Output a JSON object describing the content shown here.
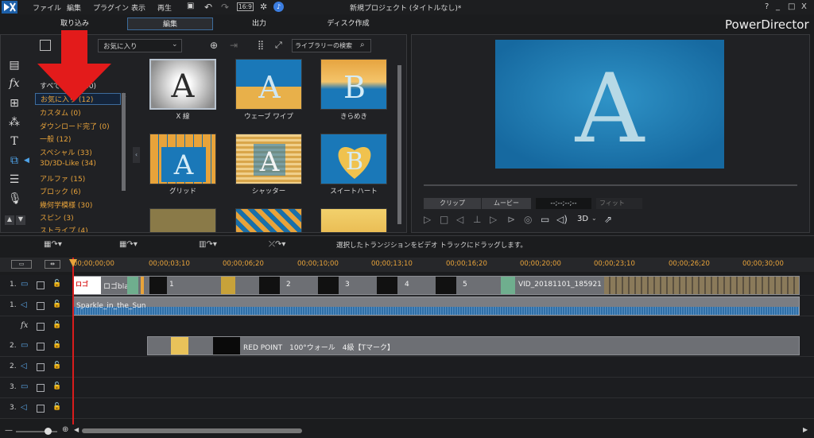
{
  "menu": {
    "file": "ファイル",
    "edit": "編集",
    "plugin": "プラグイン",
    "view": "表示",
    "play": "再生",
    "ratio": "16:9"
  },
  "window_title": "新規プロジェクト (タイトルなし)*",
  "winbtns": {
    "help": "?",
    "min": "_",
    "max": "□",
    "close": "X"
  },
  "modes": {
    "capture": "取り込み",
    "edit": "編集",
    "output": "出力",
    "disc": "ディスク作成"
  },
  "brand": "PowerDirector",
  "library": {
    "filter": "お気に入り",
    "search_placeholder": "ライブラリーの検索"
  },
  "categories": [
    {
      "label": "すべて表示 (140)"
    },
    {
      "label": "お気に入り (12)"
    },
    {
      "label": "カスタム (0)"
    },
    {
      "label": "ダウンロード完了 (0)"
    },
    {
      "label": "一般 (12)"
    },
    {
      "label": "スペシャル (33)"
    },
    {
      "label": "3D/3D-Like (34)"
    },
    {
      "label": "アルファ (15)"
    },
    {
      "label": "ブロック (6)"
    },
    {
      "label": "幾何学模様 (30)"
    },
    {
      "label": "スピン (3)"
    },
    {
      "label": "ストライプ (4)"
    }
  ],
  "thumbs": [
    {
      "label": "X 線"
    },
    {
      "label": "ウェーブ ワイプ"
    },
    {
      "label": "きらめき"
    },
    {
      "label": "グリッド"
    },
    {
      "label": "シャッター"
    },
    {
      "label": "スイートハート"
    }
  ],
  "preview": {
    "letter": "A",
    "clip_btn": "クリップ",
    "movie_btn": "ムービー",
    "timecode": "--;--;--;--",
    "fit": "フィット",
    "mode3d": "3D"
  },
  "timeline": {
    "hint": "選択したトランジションをビデオ トラックにドラッグします。",
    "ruler": [
      "00;00;00;00",
      "00;00;03;10",
      "00;00;06;20",
      "00;00;10;00",
      "00;00;13;10",
      "00;00;16;20",
      "00;00;20;00",
      "00;00;23;10",
      "00;00;26;20",
      "00;00;30;00"
    ],
    "tracks": [
      {
        "label": "1."
      },
      {
        "label": "1."
      },
      {
        "label": "fx"
      },
      {
        "label": "2."
      },
      {
        "label": "2."
      },
      {
        "label": "3."
      },
      {
        "label": "3."
      }
    ],
    "clips": {
      "v1_a": "ロゴbla",
      "v1_1": "1",
      "v1_2": "2",
      "v1_3": "3",
      "v1_4": "4",
      "v1_5": "5",
      "v1_vid": "VID_20181101_185921",
      "a1": "Sparkle_in_the_Sun",
      "v2": "RED POINT　100°ウォール　4級【Tマーク】"
    }
  },
  "colors": {
    "accent": "#e8a33a",
    "select": "#3d6c9c",
    "preview": "#1e80b4",
    "arrow": "#e31b1b"
  }
}
